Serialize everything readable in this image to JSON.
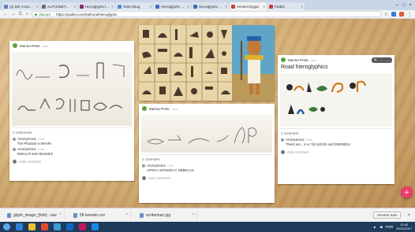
{
  "tabs": [
    {
      "label": "(2) MS Connect",
      "color": "#5b7fbf"
    },
    {
      "label": "ALPHABET...",
      "color": "#6c6c6c"
    },
    {
      "label": "Hieroglyphs for...",
      "color": "#8a2a6b"
    },
    {
      "label": "Team Blog",
      "color": "#4f8fcf"
    },
    {
      "label": "Hieroglyphs Online...",
      "color": "#3d6db5"
    },
    {
      "label": "Hieroglyphs Online...",
      "color": "#3d6db5"
    },
    {
      "label": "Ancient Egypt",
      "color": "#cc3b3b",
      "active": true
    },
    {
      "label": "Padlet",
      "color": "#cc3b3b"
    }
  ],
  "toolbar": {
    "back": "←",
    "forward": "→",
    "reload": "C",
    "home": "⌂",
    "secure_label": "Secure",
    "url": "https://padlet.com/hathoria/hieroglyphs"
  },
  "cards": {
    "left": {
      "author": "Marina Prete",
      "time": "now",
      "comments_header": "2 comments",
      "comments": [
        {
          "name": "Anonymous",
          "time": "3 hrs",
          "text": "The Pharaoh is MHARI"
        },
        {
          "name": "Anonymous",
          "time": "3 hrs",
          "text": "Bianca R and Alexandra"
        }
      ],
      "add_comment": "Add comment"
    },
    "middle": {
      "author": "Marina Prete",
      "time": "now",
      "comments_header": "1 comment",
      "comments": [
        {
          "name": "Anonymous",
          "time": "3 hrs",
          "text": "AFRICA SPANISH C REBECAS"
        }
      ],
      "add_comment": "Add comment"
    },
    "right": {
      "author": "Marina Prete",
      "time": "now",
      "title": "Road hieroglyphics",
      "comments_header": "1 comment",
      "comments": [
        {
          "name": "Anonymous",
          "time": "3 hrs",
          "text": "Theirs are... in a ?(S-)24323 and DBS38024"
        }
      ],
      "add_comment": "Add comment"
    }
  },
  "fab": {
    "label": "+"
  },
  "downloads": [
    {
      "file": "glyph_image_(fsbt)...raw",
      "caret": "^"
    },
    {
      "file": "58 tweeter.csv",
      "caret": "^"
    },
    {
      "file": "scribeman.jpg",
      "caret": "^"
    }
  ],
  "download_bar": {
    "show_all": "Mostrar tudo",
    "close": "×"
  },
  "taskbar": {
    "icons": [
      {
        "color": "#2d7fd8"
      },
      {
        "color": "#f2c230"
      },
      {
        "color": "#e24a2b"
      },
      {
        "color": "#3a9bd8"
      },
      {
        "color": "#1565c0"
      },
      {
        "color": "#c2185b"
      },
      {
        "color": "#1e88e5"
      }
    ],
    "time": "10:42",
    "date": "20/11/2017",
    "lang": "POR"
  }
}
